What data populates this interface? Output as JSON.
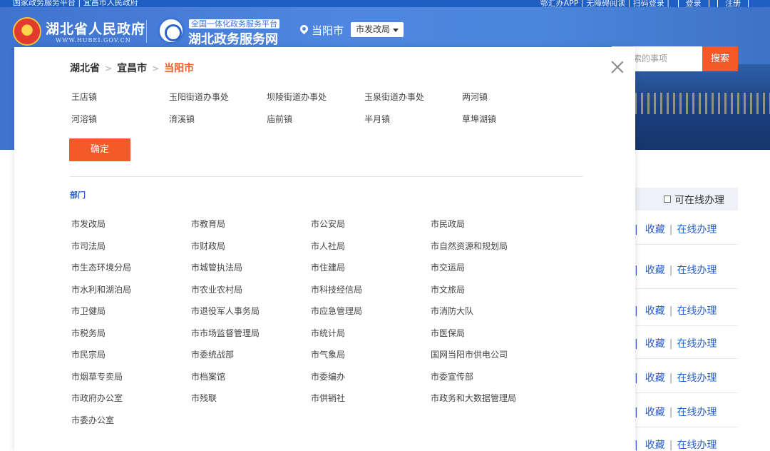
{
  "topbar": {
    "left_text": "国家政务服务平台 | 宜昌市人民政府",
    "right_text": "鄂汇办APP | 无障碍阅读 | 扫码登录 |",
    "login_label": "登录",
    "register_label": "注册"
  },
  "header": {
    "gov_name": "湖北省人民政府",
    "gov_url": "WWW.HUBEI.GOV.CN",
    "platform_tag": "全国一体化政务服务平台",
    "platform_name": "湖北政务服务网",
    "city": "当阳市",
    "dept_selected": "市发改局"
  },
  "search": {
    "placeholder": "索的事项",
    "button": "搜索"
  },
  "filter": {
    "online_label": "可在线办理"
  },
  "row_actions": {
    "favorite": "收藏",
    "separator": "|",
    "online": "在线办理"
  },
  "modal": {
    "breadcrumb": [
      "湖北省",
      "宜昌市",
      "当阳市"
    ],
    "breadcrumb_sep": ">",
    "towns": [
      "王店镇",
      "玉阳街道办事处",
      "坝陵街道办事处",
      "玉泉街道办事处",
      "两河镇",
      "河溶镇",
      "淯溪镇",
      "庙前镇",
      "半月镇",
      "草埠湖镇"
    ],
    "confirm": "确定",
    "departments_title": "部门",
    "departments": [
      "市发改局",
      "市教育局",
      "市公安局",
      "市民政局",
      "市司法局",
      "市财政局",
      "市人社局",
      "市自然资源和规划局",
      "市生态环境分局",
      "市城管执法局",
      "市住建局",
      "市交运局",
      "市水利和湖泊局",
      "市农业农村局",
      "市科技经信局",
      "市文旅局",
      "市卫健局",
      "市退役军人事务局",
      "市应急管理局",
      "市消防大队",
      "市税务局",
      "市市场监督管理局",
      "市统计局",
      "市医保局",
      "市民宗局",
      "市委统战部",
      "市气象局",
      "国网当阳市供电公司",
      "市烟草专卖局",
      "市档案馆",
      "市委编办",
      "市委宣传部",
      "市政府办公室",
      "市残联",
      "市供销社",
      "市政务和大数据管理局",
      "市委办公室"
    ]
  }
}
